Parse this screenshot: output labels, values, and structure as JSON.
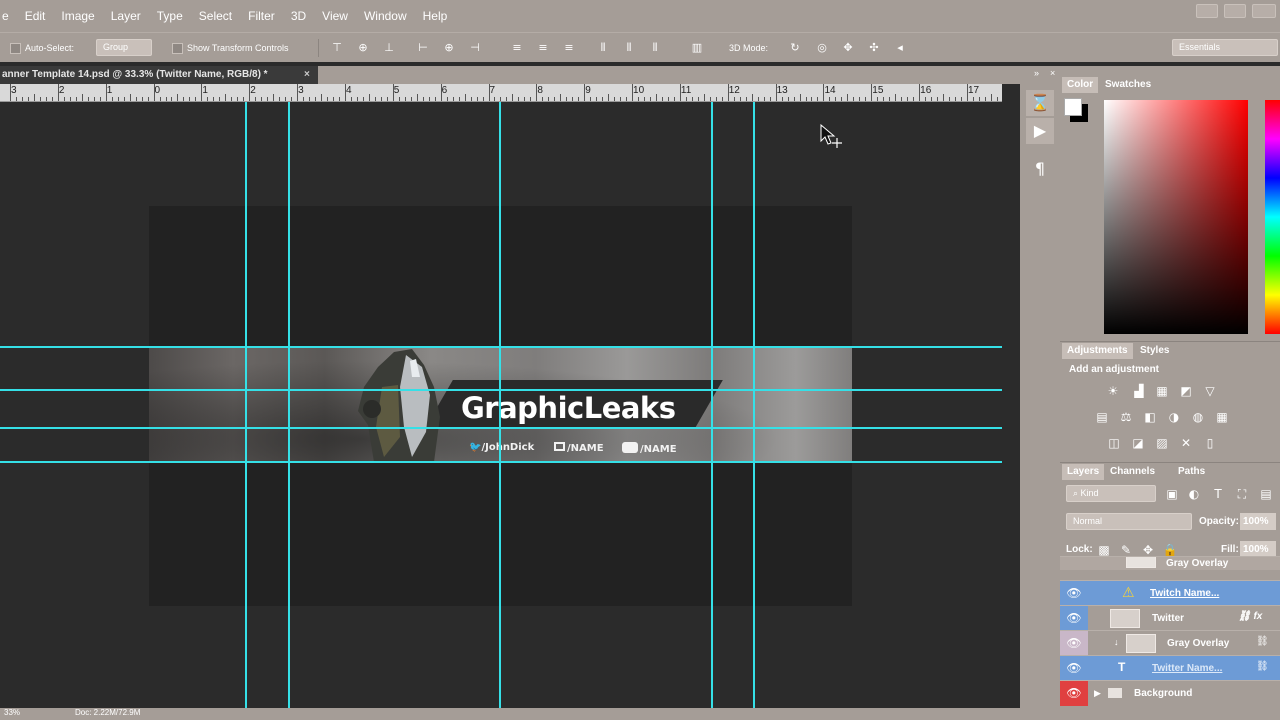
{
  "menu": [
    "e",
    "Edit",
    "Image",
    "Layer",
    "Type",
    "Select",
    "Filter",
    "3D",
    "View",
    "Window",
    "Help"
  ],
  "options": {
    "auto_select_label": "Auto-Select:",
    "auto_select_value": "Group",
    "show_transform_label": "Show Transform Controls",
    "mode_3d_label": "3D Mode:",
    "workspace_value": "Essentials"
  },
  "document": {
    "tab_title": "anner Template 14.psd @ 33.3% (Twitter Name, RGB/8) *",
    "close_glyph": "×"
  },
  "ruler": {
    "labels": [
      "3",
      "2",
      "1",
      "0",
      "1",
      "2",
      "3",
      "4",
      "5",
      "6",
      "7",
      "8",
      "9",
      "10",
      "11",
      "12",
      "13",
      "14",
      "15",
      "16",
      "17"
    ]
  },
  "banner": {
    "title": "GraphicLeaks",
    "twitter_handle": "/JohnDick",
    "twitch_name": "/NAME",
    "youtube_name": "/NAME"
  },
  "panels": {
    "color_tab": "Color",
    "swatches_tab": "Swatches",
    "adjustments_tab": "Adjustments",
    "styles_tab": "Styles",
    "add_adjustment": "Add an adjustment",
    "layers_tab": "Layers",
    "channels_tab": "Channels",
    "paths_tab": "Paths",
    "filter_kind": "Kind",
    "blend_mode": "Normal",
    "opacity_label": "Opacity:",
    "opacity_value": "100%",
    "lock_label": "Lock:",
    "fill_label": "Fill:",
    "fill_value": "100%"
  },
  "layers": [
    {
      "name": "Gray Overlay"
    },
    {
      "name": "Twitch Name..."
    },
    {
      "name": "Twitter"
    },
    {
      "name": "Gray Overlay"
    },
    {
      "name": "Twitter Name..."
    },
    {
      "name": "Background"
    }
  ],
  "status": {
    "zoom": "33%",
    "doc_size": "Doc: 2.22M/72.9M"
  },
  "colors": {
    "chrome": "#a59d97",
    "guide": "#35e0e7",
    "canvas_bg": "#2b2b2b",
    "selected_layer": "#6d9bd6",
    "visibility_red": "#e04040"
  }
}
